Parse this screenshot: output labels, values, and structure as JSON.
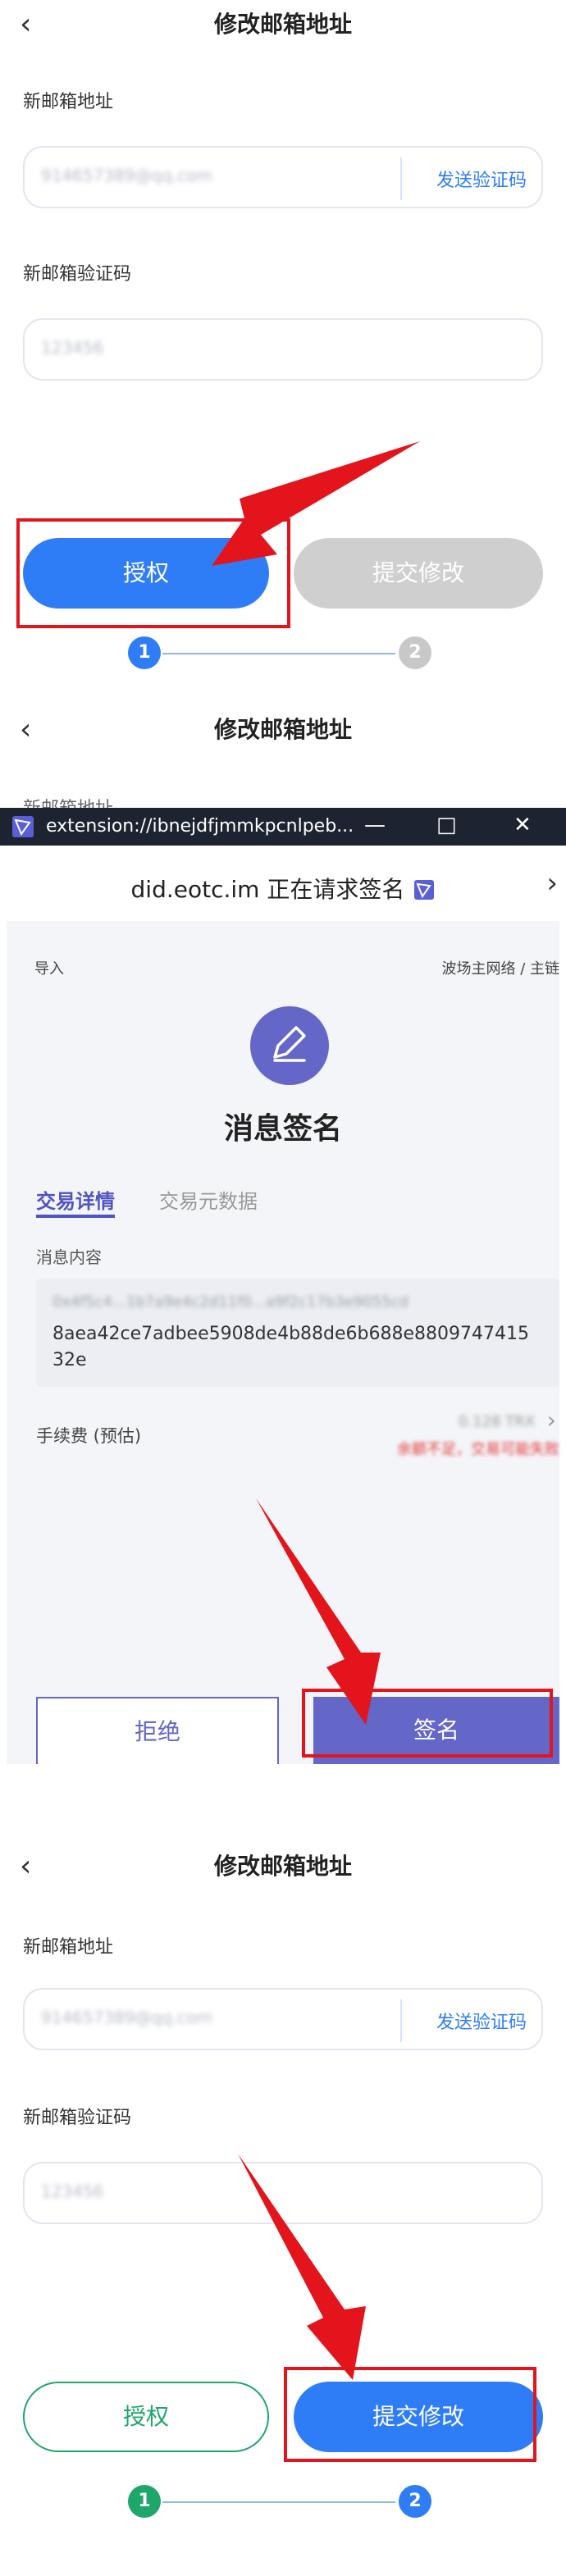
{
  "screen1": {
    "title": "修改邮箱地址",
    "back_icon": "chevron-left-icon",
    "email_label": "新邮箱地址",
    "email_value": "914657389@qq.com",
    "send_code": "发送验证码",
    "code_label": "新邮箱验证码",
    "code_value": "123456",
    "authorize": "授权",
    "submit": "提交修改",
    "step1": "1",
    "step2": "2"
  },
  "screen2": {
    "title": "修改邮箱地址",
    "partial_label": "新邮箱地址",
    "window": {
      "tab_title": "extension://ibnejdfjmmkpcnlpeb...",
      "minimize": "—",
      "restore": "□",
      "close": "✕",
      "heading": "did.eotc.im 正在请求签名",
      "import_label": "导入",
      "network": "波场主网络 / 主链",
      "sign_title": "消息签名",
      "tab_details": "交易详情",
      "tab_meta": "交易元数据",
      "message_label": "消息内容",
      "message_blur": "0x4f5c4...1b7a9e4c2d11f0...a9f2c17b3e9055cd",
      "message_text": "8aea42ce7adbee5908de4b88de6b688e880974741532e",
      "fee_label": "手续费 (预估)",
      "fee_value": "0.128 TRX",
      "warn": "余额不足，交易可能失败",
      "reject": "拒绝",
      "sign": "签名"
    }
  },
  "screen3": {
    "title": "修改邮箱地址",
    "email_label": "新邮箱地址",
    "email_value": "914657389@qq.com",
    "send_code": "发送验证码",
    "code_label": "新邮箱验证码",
    "code_value": "123456",
    "authorize": "授权",
    "submit": "提交修改",
    "step1": "1",
    "step2": "2"
  },
  "colors": {
    "primary": "#2f7df6",
    "green": "#1ea66b",
    "grey": "#cfcfcf",
    "purple": "#6466c8",
    "annotation_red": "#e3141b"
  }
}
